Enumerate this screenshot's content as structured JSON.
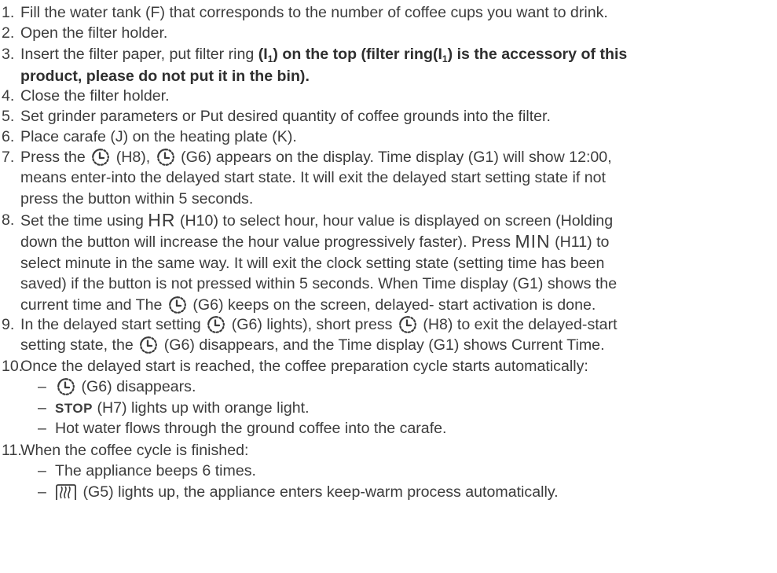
{
  "steps": [
    {
      "num": "1.",
      "text": "Fill the water tank (F) that corresponds to the number of coffee cups you want to drink."
    },
    {
      "num": "2.",
      "text": "Open the filter holder."
    },
    {
      "num": "3.",
      "parts": {
        "a": "Insert the filter paper, put filter ring ",
        "b": "(I",
        "c": "1",
        "d": ") on the top (filter ring(I",
        "e": "1",
        "f": ") is the accessory of this",
        "g": "product, please do not put it in the bin)."
      }
    },
    {
      "num": "4.",
      "text": "Close the filter holder."
    },
    {
      "num": "5.",
      "text": "Set grinder parameters or Put desired quantity of coffee grounds into the filter."
    },
    {
      "num": "6.",
      "text": "Place carafe (J) on the heating plate (K)."
    },
    {
      "num": "7.",
      "parts": {
        "a": "Press the",
        "b": "(H8),",
        "c": "(G6) appears on the display. Time display (G1) will show 12:00,",
        "d": "means enter-into the delayed start state. It will exit the delayed start setting state if not",
        "e": "press the button within 5 seconds."
      }
    },
    {
      "num": "8.",
      "parts": {
        "a": "Set the time using",
        "hr": "HR",
        "b": "(H10) to select hour, hour value is displayed on screen (Holding",
        "c": "down the button will increase the hour value progressively faster). Press",
        "min": "MIN",
        "d": "(H11) to",
        "e": "select minute in the same way. It will exit the clock setting state (setting time has been",
        "f": "saved) if the button is not pressed within 5 seconds. When Time display (G1) shows the",
        "g": "current time and The",
        "h": "(G6) keeps on the screen, delayed- start activation is done."
      }
    },
    {
      "num": "9.",
      "parts": {
        "a": "In the delayed start setting",
        "b": "(G6) lights), short press",
        "c": "(H8) to exit the delayed-start",
        "d": "setting state, the",
        "e": "(G6) disappears, and the Time display (G1) shows Current Time."
      }
    },
    {
      "num": "10.",
      "text": "Once the delayed start is reached, the coffee preparation cycle starts automatically:",
      "subs": {
        "s1": "(G6) disappears.",
        "stop": "STOP",
        "s2": "(H7) lights up with orange light.",
        "s3": "Hot water flows through the ground coffee into the carafe."
      }
    },
    {
      "num": "11.",
      "text": "When the coffee cycle is finished:",
      "subs": {
        "s1": "The appliance beeps 6 times.",
        "s2": "(G5) lights up, the appliance enters keep-warm process automatically."
      }
    }
  ],
  "dash": "–",
  "icons": {
    "clock": "delayed-start-clock-icon",
    "warm": "keep-warm-icon"
  }
}
